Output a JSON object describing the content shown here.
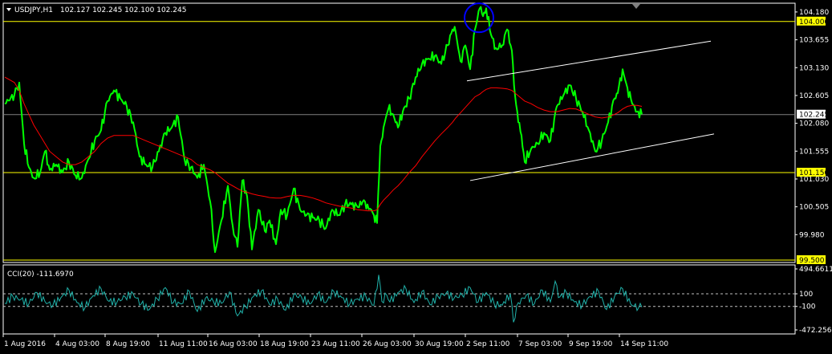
{
  "header": {
    "symbol": "USDJPY,H1",
    "ohlc": "102.127 102.245 102.100 102.245"
  },
  "indicator": {
    "label": "CCI(20) -111.6970"
  },
  "colors": {
    "background": "#000000",
    "frame": "#ffffff",
    "price": "#00ff00",
    "moving_average": "#ff0000",
    "channel": "#ffffff",
    "level": "#ffff00",
    "current_price_line": "#808080",
    "cci": "#20b2aa",
    "marker_circle": "#0000ff",
    "level_label_bg": "#ffff00",
    "level_label_text": "#000000"
  },
  "chart_data": [
    {
      "type": "line",
      "title": "USDJPY,H1",
      "price_axis_ticks": [
        104.18,
        103.655,
        103.13,
        102.605,
        102.08,
        101.555,
        101.03,
        100.505,
        99.98
      ],
      "ylim": [
        99.47,
        104.33
      ],
      "current_price": 102.245,
      "horizontal_levels": [
        104.0,
        101.15,
        99.5
      ],
      "time_axis_labels": [
        "1 Aug 2016",
        "4 Aug 03:00",
        "8 Aug 19:00",
        "11 Aug 11:00",
        "16 Aug 03:00",
        "18 Aug 19:00",
        "23 Aug 11:00",
        "26 Aug 03:00",
        "30 Aug 19:00",
        "2 Sep 11:00",
        "7 Sep 03:00",
        "9 Sep 19:00",
        "14 Sep 11:00"
      ],
      "x": [
        0,
        12,
        18,
        24,
        30,
        36,
        44,
        50,
        56,
        64,
        72,
        80,
        88,
        96,
        104,
        112,
        120,
        128,
        136,
        144,
        152,
        160,
        168,
        176,
        184,
        192,
        200,
        208,
        216,
        224,
        232,
        240,
        248,
        256,
        262,
        270,
        278,
        284,
        290,
        296,
        302,
        308,
        316,
        324,
        330,
        338,
        344,
        352,
        360,
        368,
        376,
        384,
        392,
        400,
        408,
        416,
        424,
        432,
        440,
        446,
        452,
        460,
        464,
        468,
        472,
        478,
        484,
        490,
        496,
        504,
        512,
        520,
        528,
        536,
        544,
        552,
        558,
        562,
        568,
        574,
        580,
        586,
        592,
        596,
        600,
        606,
        612,
        620,
        626,
        632,
        636,
        640,
        644,
        648,
        656,
        664,
        672,
        680,
        688,
        696,
        704,
        712,
        720,
        728,
        736,
        744,
        752,
        760,
        764,
        770,
        776,
        782,
        788,
        794
      ],
      "series": [
        {
          "role": "price",
          "values": [
            102.45,
            102.62,
            102.85,
            101.7,
            101.25,
            101.05,
            101.15,
            101.55,
            101.2,
            101.3,
            101.15,
            101.35,
            101.1,
            101.05,
            101.4,
            101.75,
            101.95,
            102.5,
            102.7,
            102.55,
            102.4,
            102.1,
            101.45,
            101.3,
            101.25,
            101.55,
            101.9,
            102.0,
            102.2,
            101.4,
            101.25,
            101.05,
            101.3,
            100.6,
            99.65,
            100.25,
            100.9,
            100.15,
            99.75,
            101.0,
            100.7,
            99.7,
            100.45,
            100.05,
            100.25,
            99.8,
            100.45,
            100.35,
            100.85,
            100.45,
            100.35,
            100.3,
            100.25,
            100.1,
            100.45,
            100.35,
            100.55,
            100.55,
            100.5,
            100.6,
            100.55,
            100.35,
            100.2,
            101.65,
            102.0,
            102.35,
            102.25,
            102.0,
            102.3,
            102.55,
            102.95,
            103.2,
            103.3,
            103.35,
            103.2,
            103.55,
            103.85,
            103.8,
            103.25,
            103.55,
            103.1,
            103.85,
            104.25,
            104.1,
            104.25,
            103.75,
            103.5,
            103.55,
            103.85,
            103.45,
            102.6,
            102.1,
            101.85,
            101.35,
            101.6,
            101.7,
            101.9,
            101.75,
            102.4,
            102.6,
            102.8,
            102.55,
            102.3,
            101.95,
            101.55,
            101.75,
            102.1,
            102.55,
            102.65,
            103.1,
            102.75,
            102.45,
            102.3,
            102.25
          ]
        },
        {
          "role": "moving_average",
          "values": [
            102.95,
            102.85,
            102.7,
            102.45,
            102.25,
            102.05,
            101.85,
            101.7,
            101.55,
            101.45,
            101.35,
            101.3,
            101.3,
            101.35,
            101.45,
            101.55,
            101.7,
            101.8,
            101.85,
            101.85,
            101.85,
            101.85,
            101.8,
            101.75,
            101.7,
            101.65,
            101.6,
            101.55,
            101.5,
            101.45,
            101.4,
            101.3,
            101.25,
            101.2,
            101.15,
            101.05,
            100.95,
            100.9,
            100.85,
            100.8,
            100.78,
            100.75,
            100.72,
            100.7,
            100.68,
            100.67,
            100.67,
            100.7,
            100.72,
            100.72,
            100.7,
            100.67,
            100.63,
            100.58,
            100.55,
            100.52,
            100.5,
            100.48,
            100.45,
            100.44,
            100.43,
            100.43,
            100.45,
            100.55,
            100.63,
            100.72,
            100.82,
            100.9,
            101.0,
            101.15,
            101.28,
            101.45,
            101.6,
            101.75,
            101.88,
            102.0,
            102.1,
            102.18,
            102.28,
            102.38,
            102.48,
            102.58,
            102.63,
            102.68,
            102.72,
            102.75,
            102.75,
            102.74,
            102.73,
            102.7,
            102.65,
            102.6,
            102.55,
            102.5,
            102.45,
            102.38,
            102.33,
            102.3,
            102.3,
            102.33,
            102.36,
            102.35,
            102.3,
            102.25,
            102.2,
            102.18,
            102.2,
            102.25,
            102.28,
            102.35,
            102.4,
            102.42,
            102.42,
            102.4
          ]
        }
      ],
      "channel_lines": [
        {
          "x": [
            576,
            880
          ],
          "y": [
            102.88,
            103.63
          ]
        },
        {
          "x": [
            580,
            884
          ],
          "y": [
            101.0,
            101.88
          ]
        }
      ],
      "highlight_circle": {
        "x": 591,
        "y": 104.07
      }
    },
    {
      "type": "line",
      "title": "CCI(20) -111.6970",
      "value_axis_ticks": [
        494.6611,
        100,
        -100,
        -472.2561
      ],
      "reference_levels": [
        100,
        -100
      ],
      "ylim": [
        -472.2561,
        494.6611
      ],
      "x": [
        0,
        10,
        20,
        30,
        40,
        50,
        60,
        70,
        80,
        90,
        100,
        110,
        120,
        130,
        140,
        150,
        160,
        170,
        180,
        190,
        200,
        210,
        220,
        230,
        240,
        250,
        260,
        270,
        280,
        290,
        300,
        310,
        320,
        330,
        340,
        350,
        360,
        370,
        380,
        390,
        400,
        410,
        420,
        430,
        440,
        450,
        460,
        466,
        470,
        476,
        480,
        490,
        500,
        510,
        520,
        530,
        540,
        550,
        560,
        570,
        580,
        590,
        600,
        610,
        620,
        630,
        634,
        640,
        650,
        660,
        670,
        680,
        686,
        690,
        700,
        710,
        720,
        730,
        740,
        750,
        760,
        770,
        780,
        790,
        794
      ],
      "values": [
        -50,
        60,
        10,
        -60,
        120,
        -20,
        -80,
        40,
        160,
        -40,
        -120,
        70,
        180,
        -20,
        -30,
        50,
        100,
        -60,
        -150,
        20,
        200,
        -40,
        -60,
        140,
        -180,
        30,
        -20,
        -50,
        130,
        -250,
        -100,
        60,
        150,
        -70,
        20,
        -160,
        80,
        40,
        -60,
        100,
        -40,
        140,
        40,
        -60,
        20,
        60,
        -80,
        400,
        -20,
        80,
        -30,
        120,
        180,
        -40,
        140,
        -70,
        60,
        110,
        30,
        80,
        200,
        -30,
        120,
        -60,
        -80,
        100,
        -350,
        -40,
        80,
        -60,
        160,
        -30,
        300,
        40,
        120,
        -30,
        -80,
        60,
        140,
        -150,
        60,
        180,
        -60,
        -120,
        -112
      ]
    }
  ]
}
